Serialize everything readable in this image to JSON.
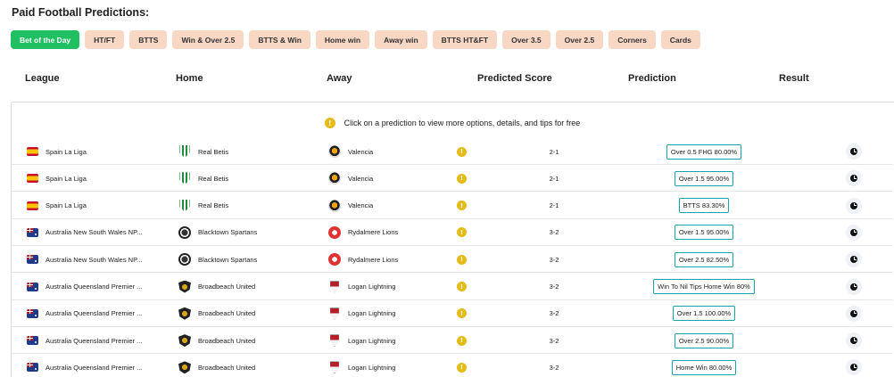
{
  "page": {
    "title": "Paid Football Predictions:"
  },
  "filters": [
    {
      "label": "Bet of the Day",
      "active": true
    },
    {
      "label": "HT/FT",
      "active": false
    },
    {
      "label": "BTTS",
      "active": false
    },
    {
      "label": "Win & Over 2.5",
      "active": false
    },
    {
      "label": "BTTS & Win",
      "active": false
    },
    {
      "label": "Home win",
      "active": false
    },
    {
      "label": "Away win",
      "active": false
    },
    {
      "label": "BTTS HT&FT",
      "active": false
    },
    {
      "label": "Over 3.5",
      "active": false
    },
    {
      "label": "Over 2.5",
      "active": false
    },
    {
      "label": "Corners",
      "active": false
    },
    {
      "label": "Cards",
      "active": false
    }
  ],
  "columns": {
    "league": "League",
    "home": "Home",
    "away": "Away",
    "predicted_score": "Predicted Score",
    "prediction": "Prediction",
    "result": "Result"
  },
  "notice": {
    "text": "Click on a prediction to view more options, details, and tips for free",
    "icon": "info-icon"
  },
  "rows": [
    {
      "flag": "spain-flag-icon",
      "league": "Spain La Liga",
      "home_crest": "real-betis-crest-icon",
      "home": "Real Betis",
      "away_crest": "valencia-crest-icon",
      "away": "Valencia",
      "score": "2-1",
      "prediction": "Over 0.5 FHG 80.00%"
    },
    {
      "flag": "spain-flag-icon",
      "league": "Spain La Liga",
      "home_crest": "real-betis-crest-icon",
      "home": "Real Betis",
      "away_crest": "valencia-crest-icon",
      "away": "Valencia",
      "score": "2-1",
      "prediction": "Over 1.5 95.00%"
    },
    {
      "flag": "spain-flag-icon",
      "league": "Spain La Liga",
      "home_crest": "real-betis-crest-icon",
      "home": "Real Betis",
      "away_crest": "valencia-crest-icon",
      "away": "Valencia",
      "score": "2-1",
      "prediction": "BTTS 83.30%"
    },
    {
      "flag": "australia-flag-icon",
      "league": "Australia New South Wales NP...",
      "home_crest": "blacktown-crest-icon",
      "home": "Blacktown Spartans",
      "away_crest": "rydalmere-crest-icon",
      "away": "Rydalmere Lions",
      "score": "3-2",
      "prediction": "Over 1.5 95.00%"
    },
    {
      "flag": "australia-flag-icon",
      "league": "Australia New South Wales NP...",
      "home_crest": "blacktown-crest-icon",
      "home": "Blacktown Spartans",
      "away_crest": "rydalmere-crest-icon",
      "away": "Rydalmere Lions",
      "score": "3-2",
      "prediction": "Over 2.5 82.50%"
    },
    {
      "flag": "australia-flag-icon",
      "league": "Australia Queensland Premier ...",
      "home_crest": "broadbeach-crest-icon",
      "home": "Broadbeach United",
      "away_crest": "logan-crest-icon",
      "away": "Logan Lightning",
      "score": "3-2",
      "prediction": "Win To Nil Tips Home Win 80%"
    },
    {
      "flag": "australia-flag-icon",
      "league": "Australia Queensland Premier ...",
      "home_crest": "broadbeach-crest-icon",
      "home": "Broadbeach United",
      "away_crest": "logan-crest-icon",
      "away": "Logan Lightning",
      "score": "3-2",
      "prediction": "Over 1.5 100.00%"
    },
    {
      "flag": "australia-flag-icon",
      "league": "Australia Queensland Premier ...",
      "home_crest": "broadbeach-crest-icon",
      "home": "Broadbeach United",
      "away_crest": "logan-crest-icon",
      "away": "Logan Lightning",
      "score": "3-2",
      "prediction": "Over 2.5 90.00%"
    },
    {
      "flag": "australia-flag-icon",
      "league": "Australia Queensland Premier ...",
      "home_crest": "broadbeach-crest-icon",
      "home": "Broadbeach United",
      "away_crest": "logan-crest-icon",
      "away": "Logan Lightning",
      "score": "3-2",
      "prediction": "Home Win 80.00%"
    }
  ],
  "colors": {
    "accent_green": "#1fbf62",
    "chip_bg": "#f8d7c4",
    "prediction_border": "#1aa1b0",
    "info_yellow": "#e5bb16"
  }
}
